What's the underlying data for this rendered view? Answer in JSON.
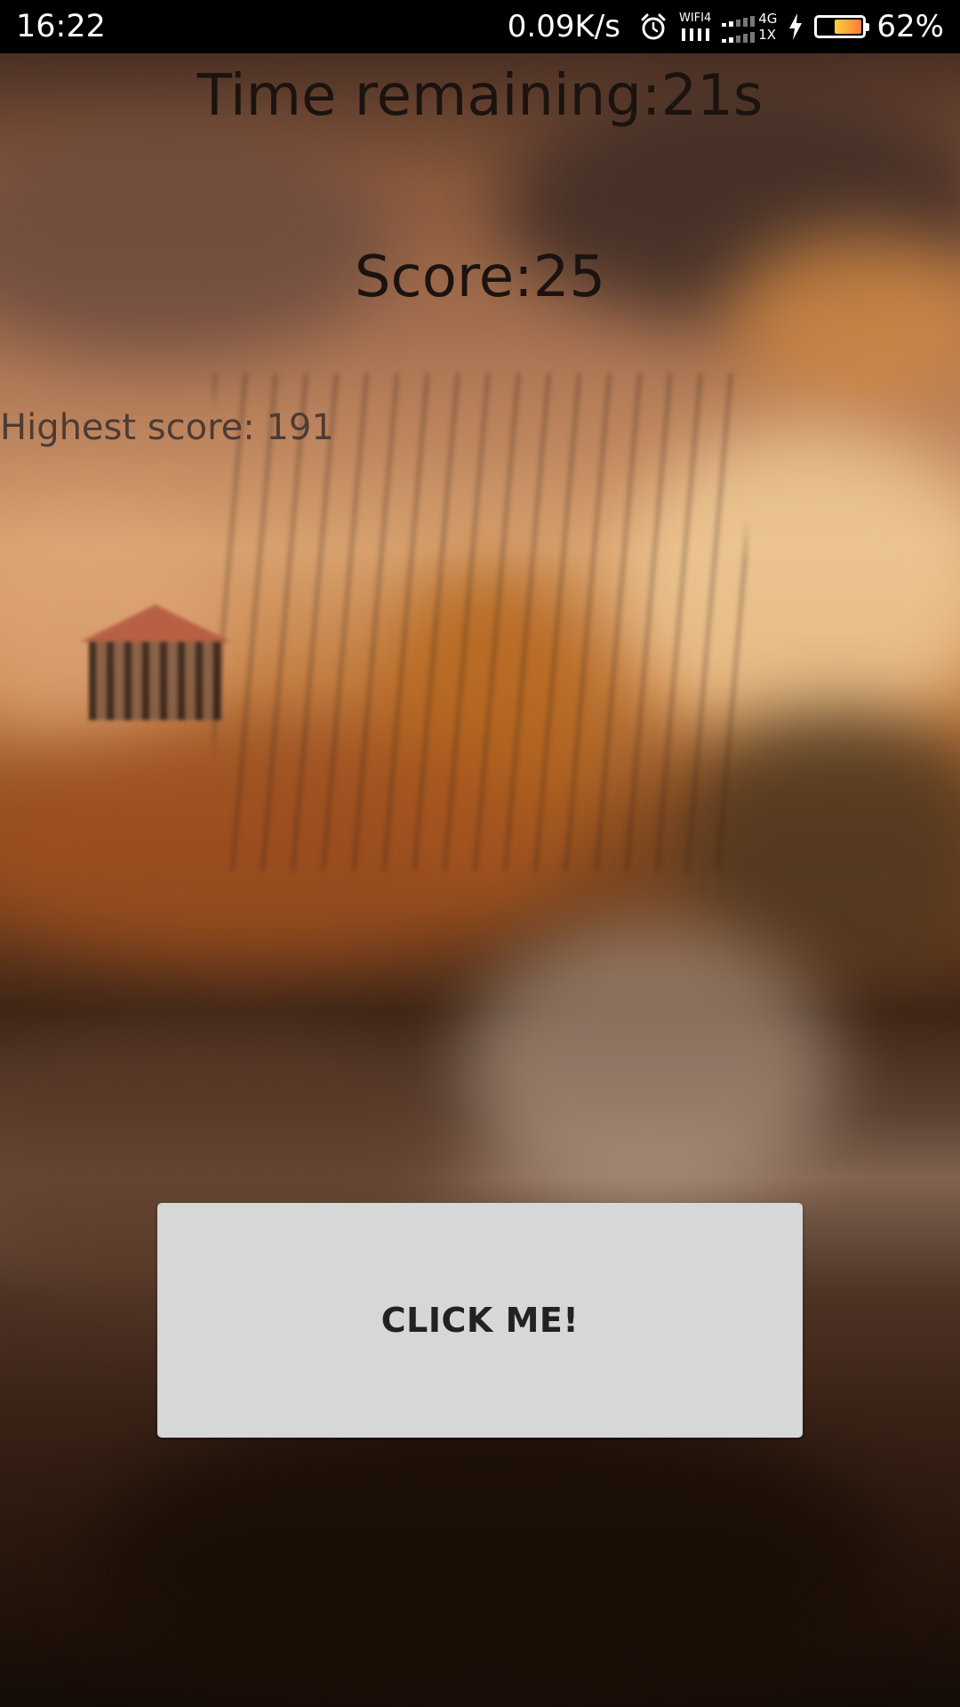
{
  "status_bar": {
    "time": "16:22",
    "network_speed": "0.09K/s",
    "wifi_label": "WIFI4",
    "network_type": "4G",
    "network_sub": "1X",
    "battery_percent": "62%",
    "battery_level": 0.62,
    "icons": [
      "alarm-clock-icon",
      "wifi-icon",
      "cellular-signal-icon",
      "charging-bolt-icon",
      "battery-icon"
    ]
  },
  "game": {
    "time_remaining": "Time remaining:21s",
    "score": "Score:25",
    "highest_score": "Highest score: 191",
    "button_label": "CLICK ME!"
  },
  "colors": {
    "status_bar_bg": "#000000",
    "button_bg": "#d6d7d7",
    "text_dark": "#1b130f"
  }
}
